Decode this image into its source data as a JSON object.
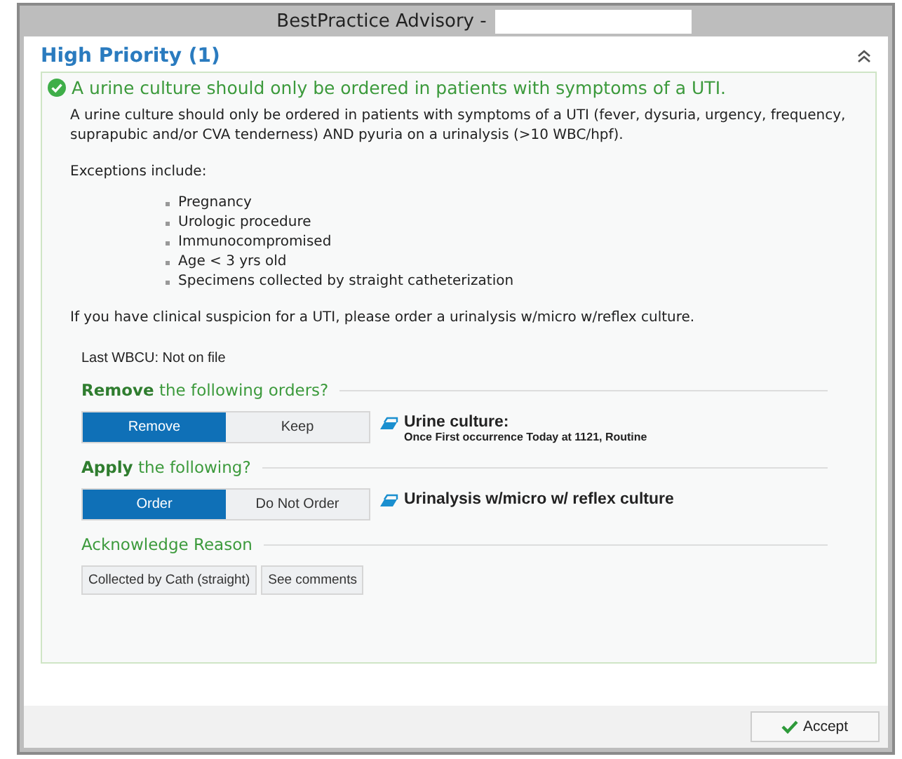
{
  "window": {
    "title": "BestPractice Advisory  -"
  },
  "section": {
    "title": "High Priority (1)",
    "collapsed": false
  },
  "advisory": {
    "headline": "A urine culture should only be ordered in patients with symptoms of a UTI.",
    "body": "A urine culture should only be ordered in patients with symptoms of a UTI (fever, dysuria, urgency, frequency, suprapubic and/or CVA tenderness) AND pyuria on a urinalysis (>10 WBC/hpf).",
    "exceptions_intro": "Exceptions include:",
    "exceptions": [
      "Pregnancy",
      "Urologic procedure",
      "Immunocompromised",
      "Age < 3 yrs old",
      "Specimens collected by straight catheterization"
    ],
    "closing": "If you have clinical suspicion for a UTI, please order a urinalysis w/micro w/reflex culture.",
    "last_result": "Last WBCU: Not on file"
  },
  "order_groups": [
    {
      "heading": "**Remove** the following orders?",
      "options": [
        {
          "label": "Remove",
          "selected": true
        },
        {
          "label": "Keep",
          "selected": false
        }
      ],
      "order_name": "Urine culture:",
      "order_detail": "Once First occurrence Today at 1121, Routine"
    },
    {
      "heading": "**Apply** the following?",
      "options": [
        {
          "label": "Order",
          "selected": true
        },
        {
          "label": "Do Not Order",
          "selected": false
        }
      ],
      "order_name": "Urinalysis w/micro w/ reflex culture"
    }
  ],
  "acknowledge": {
    "heading": "Acknowledge Reason",
    "reasons": [
      {
        "label": "Collected by Cath (straight)",
        "selected": false
      },
      {
        "label": "See comments",
        "selected": false
      }
    ]
  },
  "footer": {
    "accept_label": "Accept"
  }
}
